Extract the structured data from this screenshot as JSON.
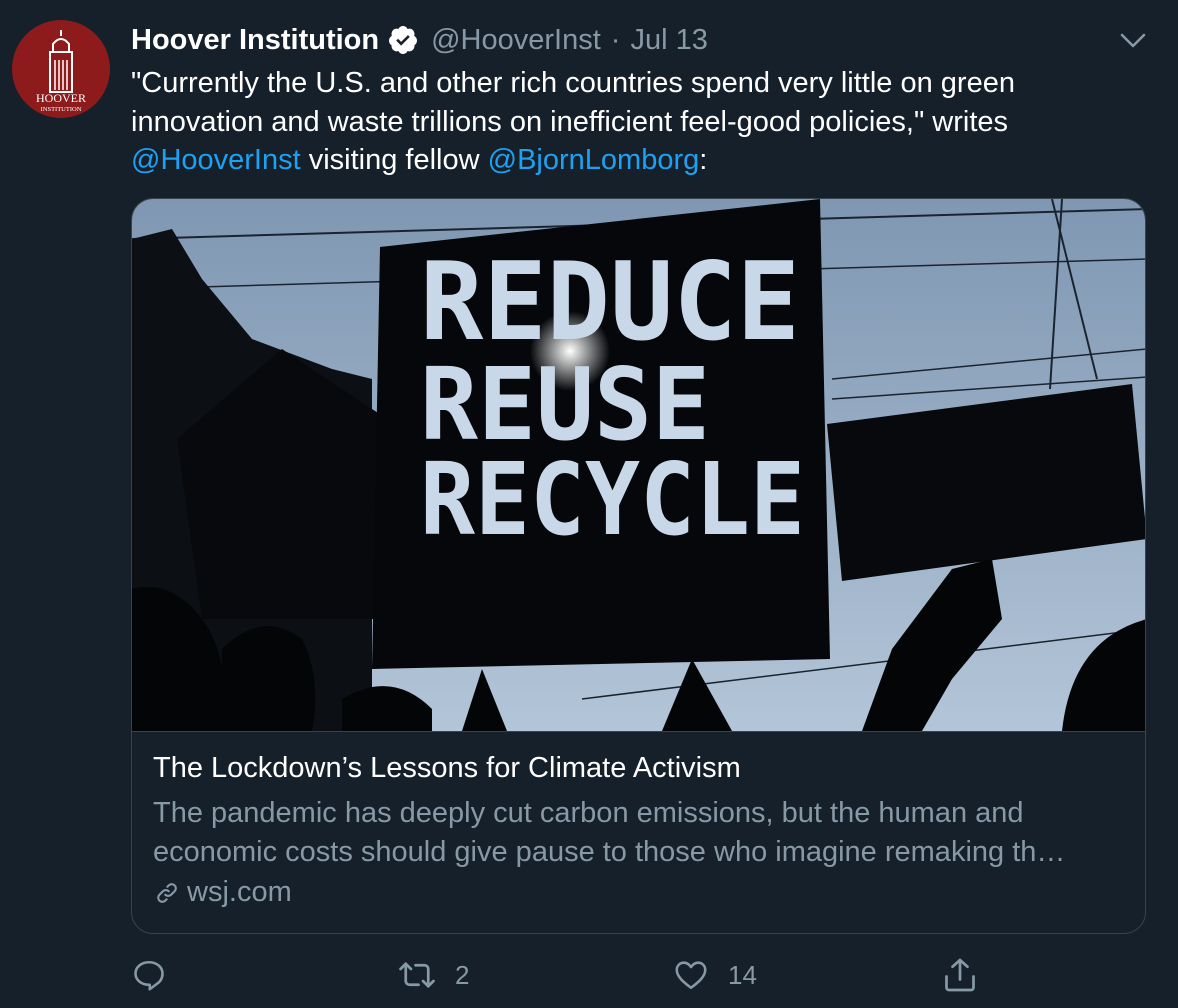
{
  "tweet": {
    "display_name": "Hoover Institution",
    "handle": "@HooverInst",
    "separator": "·",
    "date": "Jul 13",
    "avatar_line1": "HOOVER",
    "avatar_line2": "INSTITUTION",
    "text_part1": "\"Currently the U.S. and other rich countries spend very little on green innovation and waste trillions on inefficient feel-good policies,\" writes ",
    "mention1": "@HooverInst",
    "text_part2": " visiting fellow ",
    "mention2": "@BjornLomborg",
    "text_part3": ":"
  },
  "card": {
    "sign_line1": "REDUCE",
    "sign_line2": "REUSE",
    "sign_line3": "RECYCLE",
    "title": "The Lockdown’s Lessons for Climate Activism",
    "description": "The pandemic has deeply cut carbon emissions, but the human and economic costs should give pause to those who imagine remaking th…",
    "domain": "wsj.com"
  },
  "actions": {
    "reply_icon": "reply-icon",
    "retweet_icon": "retweet-icon",
    "retweet_count": "2",
    "like_icon": "heart-icon",
    "like_count": "14",
    "share_icon": "share-icon"
  },
  "colors": {
    "background": "#15202b",
    "text": "#ffffff",
    "secondary": "#8899a6",
    "link": "#1da1f2",
    "border": "#38444d",
    "avatar": "#8e1b1b"
  }
}
